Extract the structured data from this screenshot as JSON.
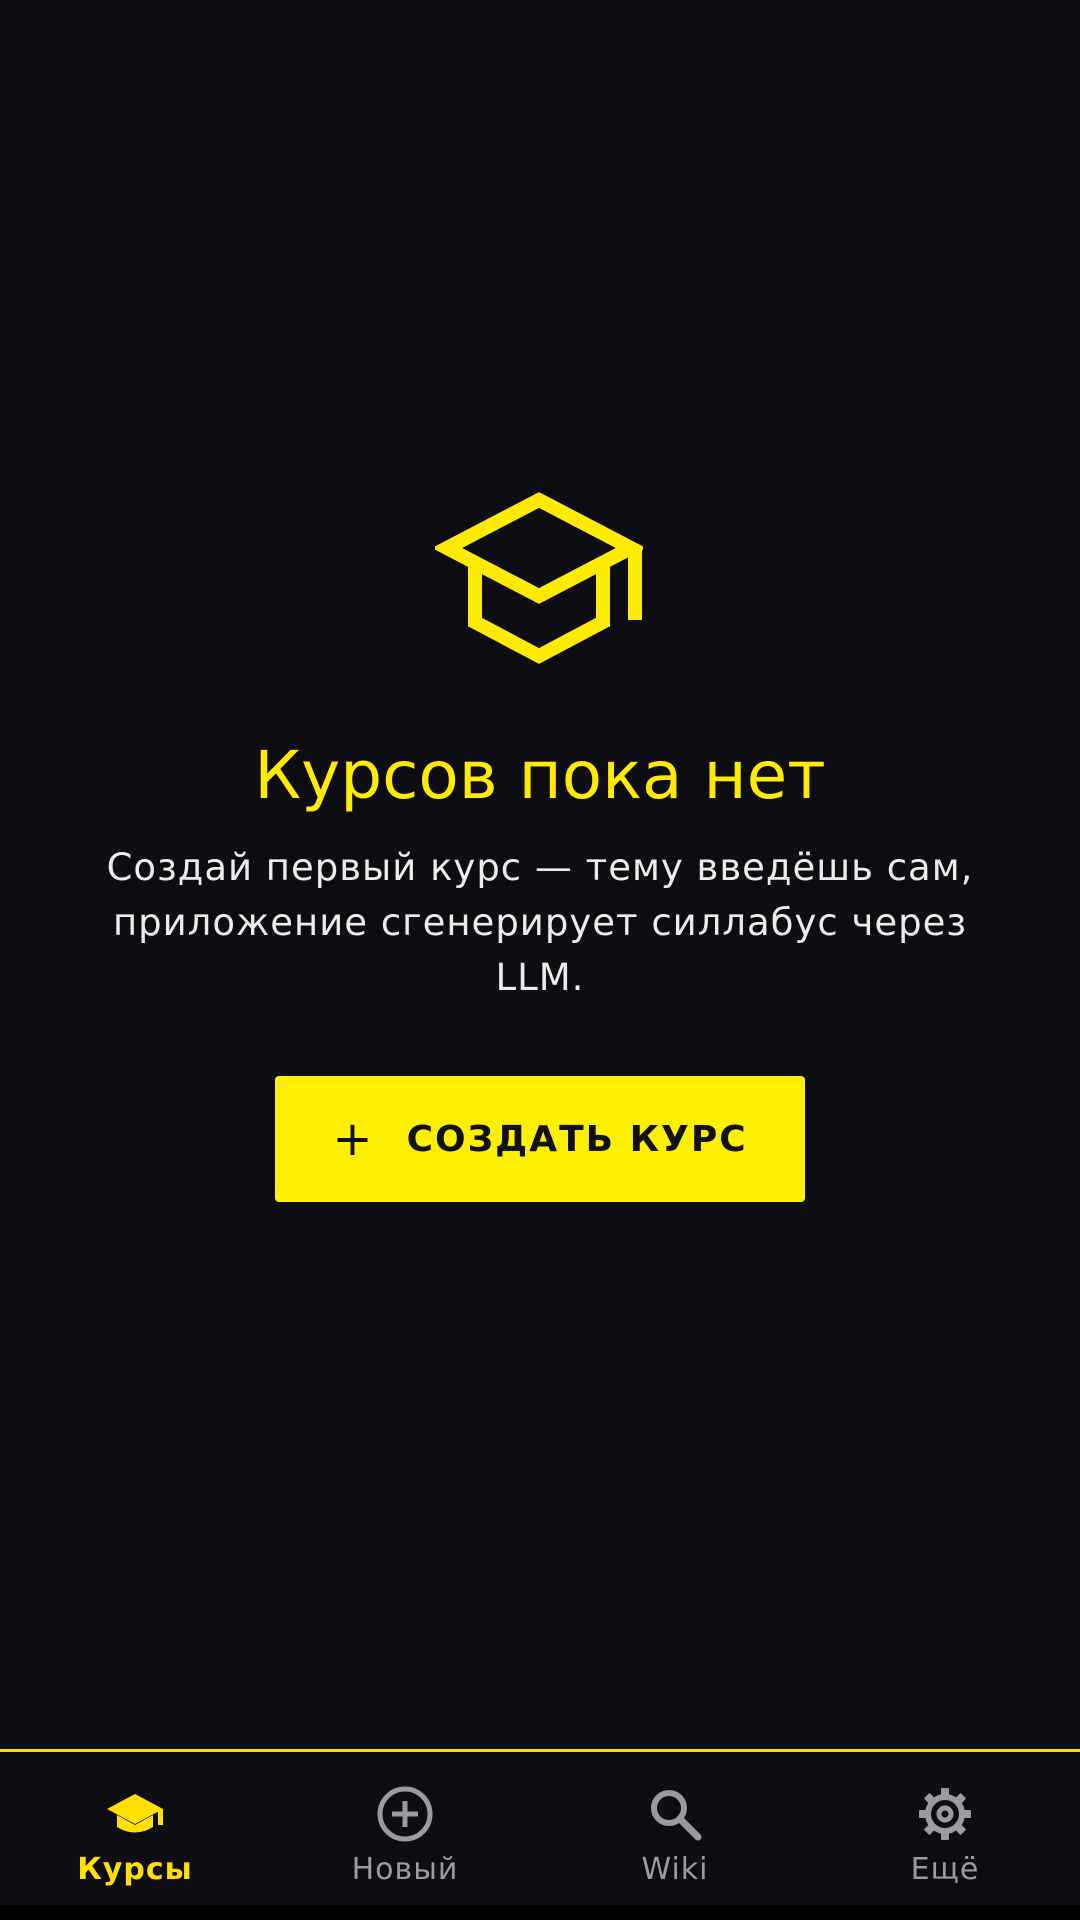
{
  "empty_state": {
    "icon": "graduation-cap-icon",
    "title": "Курсов пока нет",
    "description": "Создай первый курс — тему введёшь сам, приложение сгенерирует силлабус через LLM.",
    "create_button": {
      "icon": "plus-icon",
      "icon_glyph": "+",
      "label": "СОЗДАТЬ КУРС"
    }
  },
  "bottom_nav": {
    "active_index": 0,
    "items": [
      {
        "label": "Курсы",
        "icon": "graduation-cap-icon",
        "active": true
      },
      {
        "label": "Новый",
        "icon": "add-circle-icon",
        "active": false
      },
      {
        "label": "Wiki",
        "icon": "search-icon",
        "active": false
      },
      {
        "label": "Ещё",
        "icon": "gear-icon",
        "active": false
      }
    ]
  },
  "colors": {
    "background": "#0e0e12",
    "accent": "#ffeb00",
    "text_primary": "#ececec",
    "text_muted": "#9a9aa0",
    "button_text": "#111111"
  }
}
